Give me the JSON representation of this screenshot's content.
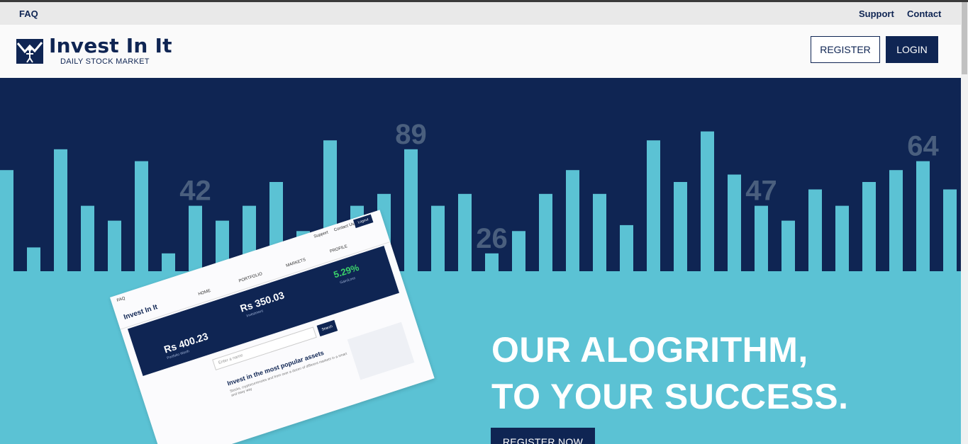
{
  "utility_nav": {
    "faq": "FAQ",
    "support": "Support",
    "contact": "Contact"
  },
  "header": {
    "logo_title": "Invest In It",
    "logo_subtitle": "DAILY STOCK MARKET",
    "register_label": "REGISTER",
    "login_label": "LOGIN"
  },
  "hero": {
    "bar_values": [
      68,
      16,
      82,
      44,
      34,
      74,
      12,
      44,
      34,
      44,
      60,
      27,
      88,
      44,
      52,
      82,
      44,
      52,
      12,
      27,
      52,
      68,
      52,
      31,
      88,
      60,
      94,
      65,
      44,
      34,
      55,
      44,
      60,
      68,
      74,
      55
    ],
    "bar_labels": [
      {
        "text": "42",
        "bar": 7
      },
      {
        "text": "89",
        "bar": 15
      },
      {
        "text": "26",
        "bar": 18
      },
      {
        "text": "47",
        "bar": 28
      },
      {
        "text": "64",
        "bar": 34
      }
    ],
    "title_line1": "OUR ALOGRITHM,",
    "title_line2": "TO YOUR SUCCESS.",
    "cta_label": "REGISTER NOW"
  },
  "mockup": {
    "top_left": "FAQ",
    "top_right1": "Support",
    "top_right2": "Contact Us",
    "top_button": "Logout",
    "logo": "Invest In It",
    "nav": [
      "HOME",
      "PORTFOLIO",
      "MARKETS",
      "PROFILE"
    ],
    "value1": "Rs 400.23",
    "value1_sub": "Portfolio Worth",
    "value2": "Rs 350.03",
    "value2_sub": "Investment",
    "value3": "5.29%",
    "value3_sub": "Gain/Loss",
    "search_placeholder": "Enter a name",
    "search_button": "Search",
    "heading": "Invest in the most popular assets",
    "text": "Stocks, cryptocurrencies and from over a dozen of different markets in a smart and easy way"
  },
  "colors": {
    "navy": "#0f2553",
    "cyan": "#5bc2d4",
    "label": "#4a5f7e"
  }
}
